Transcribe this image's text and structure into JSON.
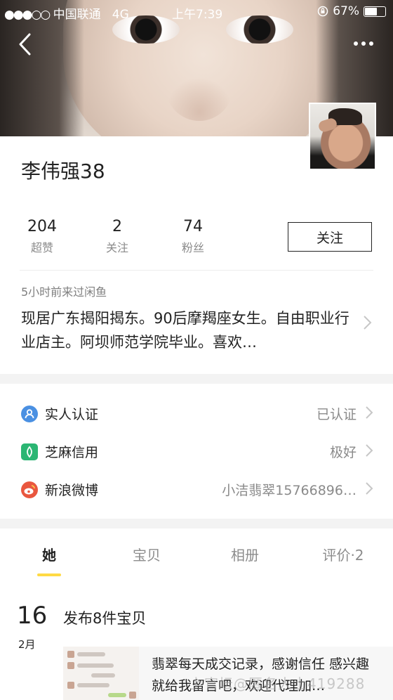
{
  "status_bar": {
    "signal": "●●●○○",
    "carrier": "中国联通",
    "network": "4G",
    "time": "上午7:39",
    "battery": "67%",
    "battery_level": 0.67
  },
  "profile": {
    "username": "李伟强38",
    "follow_label": "关注",
    "stats": [
      {
        "value": "204",
        "label": "超赞"
      },
      {
        "value": "2",
        "label": "关注"
      },
      {
        "value": "74",
        "label": "粉丝"
      }
    ],
    "last_visit": "5小时前来过闲鱼",
    "bio": "现居广东揭阳揭东。90后摩羯座女生。自由职业行业店主。阿坝师范学院毕业。喜欢…"
  },
  "verifications": [
    {
      "title": "实人认证",
      "value": "已认证",
      "icon": "person-verify-icon",
      "color": "#4a90e2"
    },
    {
      "title": "芝麻信用",
      "value": "极好",
      "icon": "sesame-credit-icon",
      "color": "#2bb673"
    },
    {
      "title": "新浪微博",
      "value": "小洁翡翠15766896…",
      "icon": "weibo-icon",
      "color": "#e9573f"
    }
  ],
  "tabs": [
    {
      "label": "她",
      "active": true
    },
    {
      "label": "宝贝",
      "active": false
    },
    {
      "label": "相册",
      "active": false
    },
    {
      "label": "评价·2",
      "active": false
    }
  ],
  "feed": {
    "day": "16",
    "month": "2月",
    "title": "发布8件宝贝",
    "text": "翡翠每天成交记录，感谢信任 感兴趣就给我留言吧，欢迎代理加…",
    "watermark": "上官坛@匿名人士419288"
  },
  "colors": {
    "accent_yellow": "#ffda44",
    "text_primary": "#222222",
    "text_secondary": "#8a8a8a"
  }
}
